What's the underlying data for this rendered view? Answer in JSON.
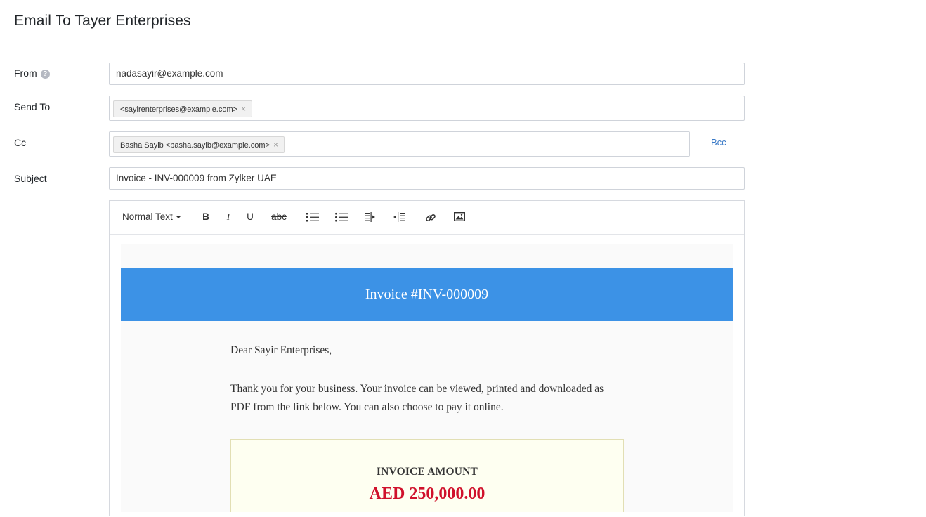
{
  "window": {
    "title": "Email To Tayer Enterprises"
  },
  "form": {
    "from_label": "From",
    "from_value": "nadasayir@example.com",
    "send_to_label": "Send To",
    "send_to_chips": [
      "<sayirenterprises@example.com>"
    ],
    "cc_label": "Cc",
    "cc_chips": [
      "Basha Sayib <basha.sayib@example.com>"
    ],
    "bcc_label": "Bcc",
    "subject_label": "Subject",
    "subject_value": "Invoice - INV-000009 from Zylker UAE",
    "chip_remove_glyph": "×"
  },
  "toolbar": {
    "format_label": "Normal Text",
    "bold": "B",
    "italic": "I",
    "underline": "U",
    "strike": "abc"
  },
  "email": {
    "banner_title": "Invoice #INV-000009",
    "greeting": "Dear  Sayir Enterprises,",
    "body": "Thank you for your business. Your invoice can be viewed, printed and downloaded as PDF from the link below. You can also choose to pay it online.",
    "amount_label": "INVOICE AMOUNT",
    "amount_value": "AED 250,000.00"
  },
  "colors": {
    "banner": "#3c92e6",
    "amount": "#d0112b",
    "link": "#3a7ac7"
  }
}
